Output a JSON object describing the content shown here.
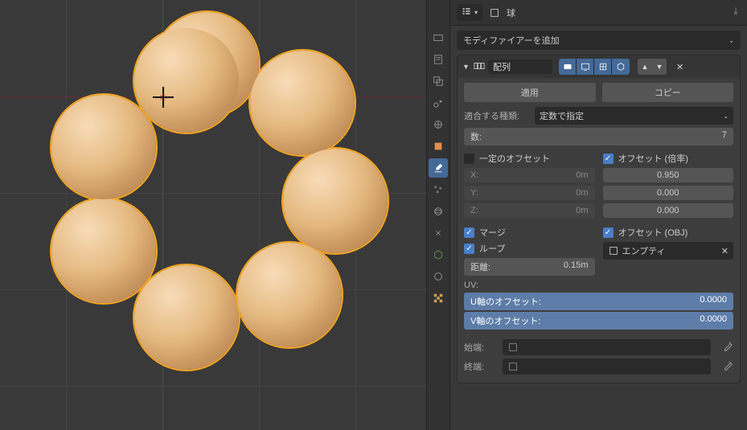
{
  "header": {
    "object_name": "球"
  },
  "add_modifier": "モディファイアーを追加",
  "modifier": {
    "name": "配列",
    "apply": "適用",
    "copy": "コピー",
    "fit_type_label": "適合する種類:",
    "fit_type_value": "定数で指定",
    "count_label": "数:",
    "count_value": "7",
    "constant_offset_label": "一定のオフセット",
    "relative_offset_label": "オフセット (倍率)",
    "constant": {
      "x": "0m",
      "y": "0m",
      "z": "0m"
    },
    "relative": {
      "x": "0.950",
      "y": "0.000",
      "z": "0.000"
    },
    "merge_label": "マージ",
    "first_last_label": "ループ",
    "merge_distance_label": "距離:",
    "merge_distance": "0.15m",
    "object_offset_label": "オフセット (OBJ)",
    "object_offset_target": "エンプティ",
    "uv_label": "UV:",
    "u_offset_label": "U軸のオフセット:",
    "v_offset_label": "V軸のオフセット:",
    "u_offset": "0.0000",
    "v_offset": "0.0000",
    "start_cap_label": "始端:",
    "end_cap_label": "終端:"
  }
}
